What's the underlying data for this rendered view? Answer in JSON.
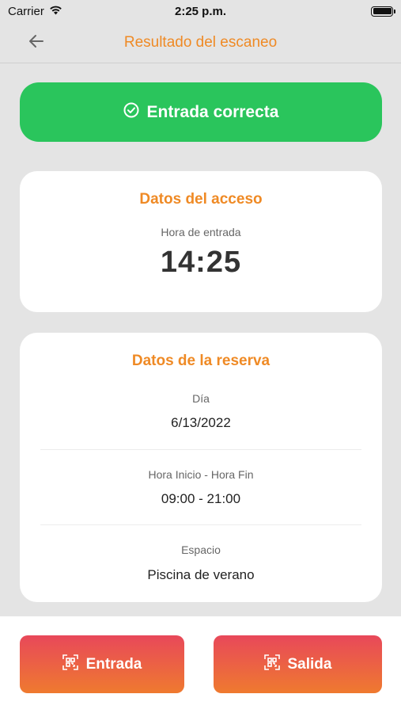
{
  "status_bar": {
    "carrier": "Carrier",
    "time": "2:25 p.m."
  },
  "nav": {
    "title": "Resultado del escaneo",
    "back_icon": "arrow-left-icon"
  },
  "banner": {
    "text": "Entrada correcta",
    "icon": "check-circle-icon",
    "color": "#2ac55c"
  },
  "access": {
    "title": "Datos del acceso",
    "entry_label": "Hora de entrada",
    "entry_time": "14:25"
  },
  "booking": {
    "title": "Datos de la reserva",
    "day_label": "Día",
    "day_value": "6/13/2022",
    "hours_label": "Hora Inicio - Hora Fin",
    "hours_value": "09:00 - 21:00",
    "space_label": "Espacio",
    "space_value": "Piscina de verano"
  },
  "actions": {
    "entrada_label": "Entrada",
    "salida_label": "Salida",
    "icon": "qr-scan-icon",
    "gradient": [
      "#e8485a",
      "#ef7a2f"
    ]
  },
  "colors": {
    "accent": "#ef8a25",
    "success": "#2ac55c",
    "background": "#e4e4e4"
  }
}
